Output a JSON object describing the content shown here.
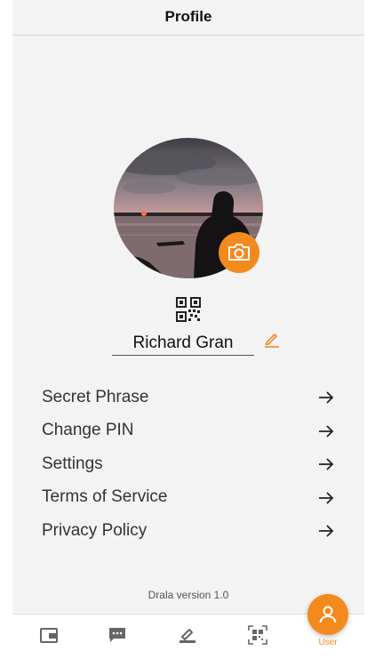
{
  "header": {
    "title": "Profile"
  },
  "profile": {
    "name": "Richard Gran",
    "avatar_icon": "profile-photo",
    "camera_icon": "camera-icon",
    "qr_icon": "qr-code-icon",
    "edit_icon": "edit-pencil-icon"
  },
  "menu": {
    "items": [
      {
        "label": "Secret Phrase",
        "icon": "arrow-right-icon"
      },
      {
        "label": "Change PIN",
        "icon": "arrow-right-icon"
      },
      {
        "label": "Settings",
        "icon": "arrow-right-icon"
      },
      {
        "label": "Terms of Service",
        "icon": "arrow-right-icon"
      },
      {
        "label": "Privacy Policy",
        "icon": "arrow-right-icon"
      }
    ]
  },
  "footer": {
    "version": "Drala version 1.0"
  },
  "tabbar": {
    "tabs": [
      {
        "icon": "wallet-icon",
        "label": ""
      },
      {
        "icon": "chat-icon",
        "label": ""
      },
      {
        "icon": "sign-icon",
        "label": ""
      },
      {
        "icon": "qr-scan-icon",
        "label": ""
      },
      {
        "icon": "user-icon",
        "label": "User",
        "active": true
      }
    ]
  },
  "colors": {
    "accent": "#f28a1d",
    "background": "#f3f3f3",
    "text": "#333333"
  }
}
